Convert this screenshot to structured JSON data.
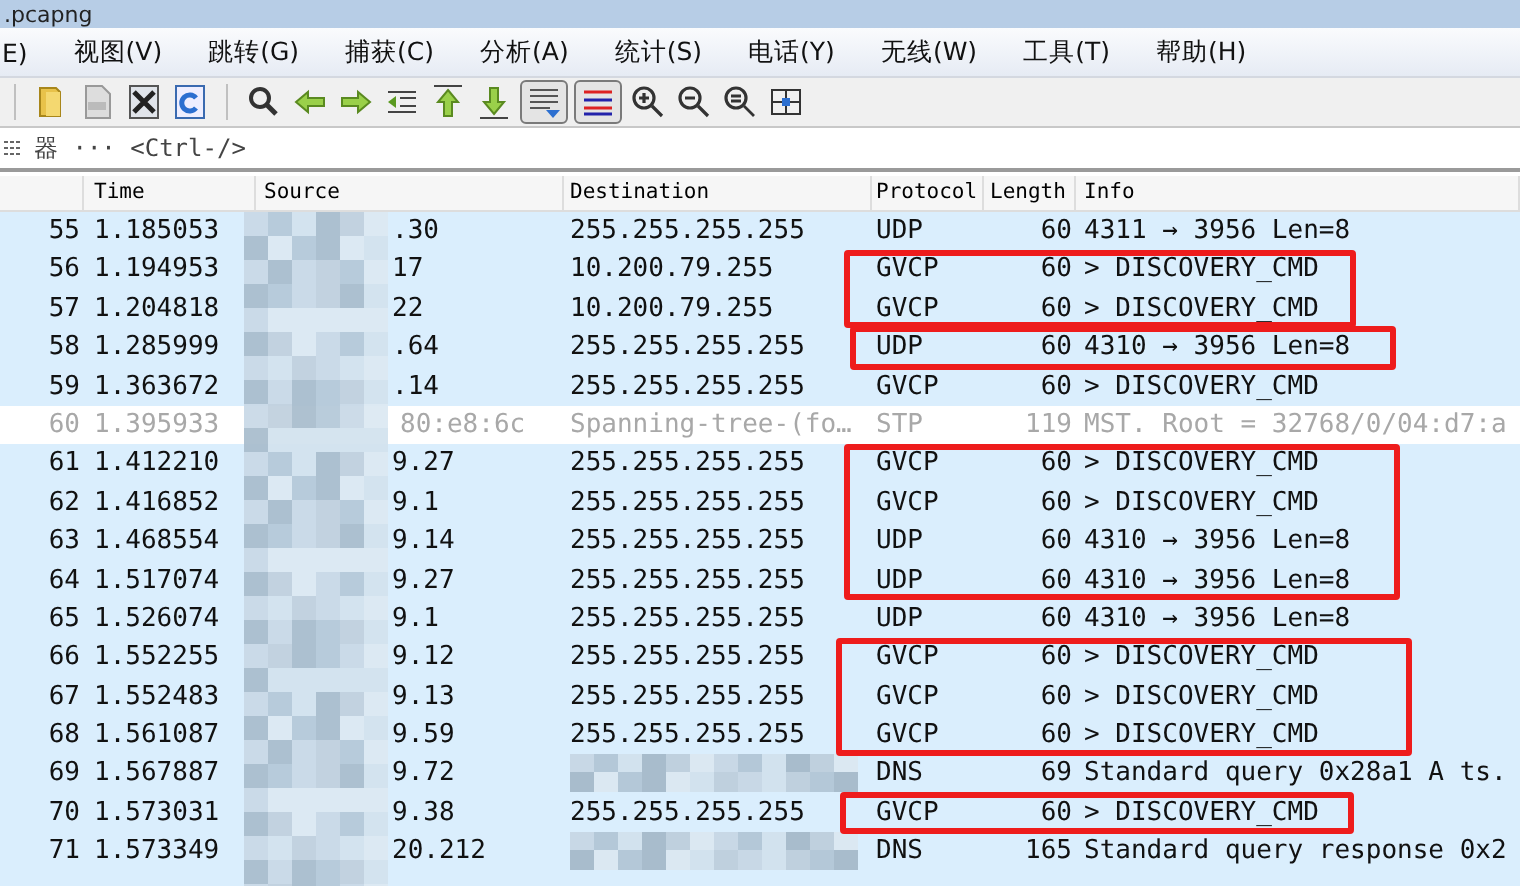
{
  "window": {
    "title": ".pcapng"
  },
  "menu": [
    "E)",
    "视图(V)",
    "跳转(G)",
    "捕获(C)",
    "分析(A)",
    "统计(S)",
    "电话(Y)",
    "无线(W)",
    "工具(T)",
    "帮助(H)"
  ],
  "toolbar": [
    {
      "kind": "separator"
    },
    {
      "kind": "open",
      "pressed": false
    },
    {
      "kind": "file",
      "pressed": false
    },
    {
      "kind": "close",
      "pressed": false
    },
    {
      "kind": "reload",
      "pressed": false
    },
    {
      "kind": "separator"
    },
    {
      "kind": "find",
      "pressed": false
    },
    {
      "kind": "back",
      "pressed": false
    },
    {
      "kind": "forward",
      "pressed": false
    },
    {
      "kind": "goto",
      "pressed": false
    },
    {
      "kind": "first",
      "pressed": false
    },
    {
      "kind": "last",
      "pressed": false
    },
    {
      "kind": "autoscroll",
      "pressed": true
    },
    {
      "kind": "colorize",
      "pressed": true
    },
    {
      "kind": "zoom_in",
      "pressed": false
    },
    {
      "kind": "zoom_out",
      "pressed": false
    },
    {
      "kind": "zoom_reset",
      "pressed": false
    },
    {
      "kind": "resize",
      "pressed": false
    }
  ],
  "filter": {
    "placeholder": "器 ··· <Ctrl-/>"
  },
  "packet_list": {
    "columns": [
      "Time",
      "Source",
      "Destination",
      "Protocol",
      "Length",
      "Info"
    ],
    "rows": [
      {
        "kind": "row",
        "no": "55",
        "time": "1.185053",
        "source": ".30",
        "destination": "255.255.255.255",
        "protocol": "UDP",
        "length": "60",
        "info": "4311 → 3956  Len=8",
        "color": "#daeefd",
        "dimmed": false
      },
      {
        "kind": "annotation_box",
        "rows": [
          {
            "kind": "row",
            "no": "56",
            "time": "1.194953",
            "source": "17",
            "destination": "10.200.79.255",
            "protocol": "GVCP",
            "length": "60",
            "info": "> DISCOVERY_CMD",
            "color": "#daeefd",
            "dimmed": false
          },
          {
            "kind": "row",
            "no": "57",
            "time": "1.204818",
            "source": "22",
            "destination": "10.200.79.255",
            "protocol": "GVCP",
            "length": "60",
            "info": "> DISCOVERY_CMD",
            "color": "#daeefd",
            "dimmed": false
          }
        ]
      },
      {
        "kind": "annotation_box",
        "rows": [
          {
            "kind": "row",
            "no": "58",
            "time": "1.285999",
            "source": ".64",
            "destination": "255.255.255.255",
            "protocol": "UDP",
            "length": "60",
            "info": "4310 → 3956  Len=8",
            "color": "#daeefd",
            "dimmed": false
          }
        ]
      },
      {
        "kind": "row",
        "no": "59",
        "time": "1.363672",
        "source": ".14",
        "destination": "255.255.255.255",
        "protocol": "GVCP",
        "length": "60",
        "info": "> DISCOVERY_CMD",
        "color": "#daeefd",
        "dimmed": false
      },
      {
        "kind": "row",
        "no": "60",
        "time": "1.395933",
        "source": "80:e8:6c",
        "destination": "Spanning-tree-(fo…",
        "protocol": "STP",
        "length": "119",
        "info": "MST. Root = 32768/0/04:d7:a",
        "color": "#ffffff",
        "dimmed": true
      },
      {
        "kind": "annotation_box",
        "rows": [
          {
            "kind": "row",
            "no": "61",
            "time": "1.412210",
            "source": "9.27",
            "destination": "255.255.255.255",
            "protocol": "GVCP",
            "length": "60",
            "info": "> DISCOVERY_CMD",
            "color": "#daeefd",
            "dimmed": false
          },
          {
            "kind": "row",
            "no": "62",
            "time": "1.416852",
            "source": "9.1",
            "destination": "255.255.255.255",
            "protocol": "GVCP",
            "length": "60",
            "info": "> DISCOVERY_CMD",
            "color": "#daeefd",
            "dimmed": false
          },
          {
            "kind": "row",
            "no": "63",
            "time": "1.468554",
            "source": "9.14",
            "destination": "255.255.255.255",
            "protocol": "UDP",
            "length": "60",
            "info": "4310 → 3956  Len=8",
            "color": "#daeefd",
            "dimmed": false
          },
          {
            "kind": "row",
            "no": "64",
            "time": "1.517074",
            "source": "9.27",
            "destination": "255.255.255.255",
            "protocol": "UDP",
            "length": "60",
            "info": "4310 → 3956  Len=8",
            "color": "#daeefd",
            "dimmed": false
          }
        ]
      },
      {
        "kind": "row",
        "no": "65",
        "time": "1.526074",
        "source": "9.1",
        "destination": "255.255.255.255",
        "protocol": "UDP",
        "length": "60",
        "info": "4310 → 3956  Len=8",
        "color": "#daeefd",
        "dimmed": false
      },
      {
        "kind": "annotation_box",
        "rows": [
          {
            "kind": "row",
            "no": "66",
            "time": "1.552255",
            "source": "9.12",
            "destination": "255.255.255.255",
            "protocol": "GVCP",
            "length": "60",
            "info": "> DISCOVERY_CMD",
            "color": "#daeefd",
            "dimmed": false
          },
          {
            "kind": "row",
            "no": "67",
            "time": "1.552483",
            "source": "9.13",
            "destination": "255.255.255.255",
            "protocol": "GVCP",
            "length": "60",
            "info": "> DISCOVERY_CMD",
            "color": "#daeefd",
            "dimmed": false
          },
          {
            "kind": "row",
            "no": "68",
            "time": "1.561087",
            "source": "9.59",
            "destination": "255.255.255.255",
            "protocol": "GVCP",
            "length": "60",
            "info": "> DISCOVERY_CMD",
            "color": "#daeefd",
            "dimmed": false
          }
        ]
      },
      {
        "kind": "row",
        "no": "69",
        "time": "1.567887",
        "source": "9.72",
        "protocol": "DNS",
        "length": "69",
        "info": "Standard query 0x28a1 A ts.",
        "color": "#daeefd",
        "dimmed": false
      },
      {
        "kind": "annotation_box",
        "rows": [
          {
            "kind": "row",
            "no": "70",
            "time": "1.573031",
            "source": "9.38",
            "destination": "255.255.255.255",
            "protocol": "GVCP",
            "length": "60",
            "info": "> DISCOVERY_CMD",
            "color": "#daeefd",
            "dimmed": false
          }
        ]
      },
      {
        "kind": "row",
        "no": "71",
        "time": "1.573349",
        "source": "20.212",
        "protocol": "DNS",
        "length": "165",
        "info": "Standard query response 0x2",
        "color": "#daeefd",
        "dimmed": false
      }
    ]
  }
}
